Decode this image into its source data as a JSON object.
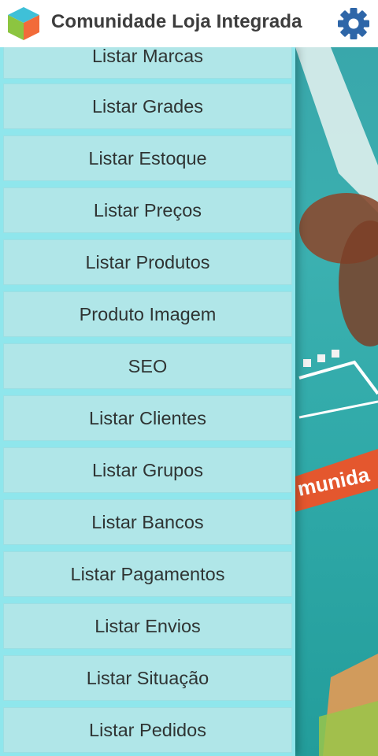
{
  "header": {
    "title": "Comunidade Loja Integrada",
    "logo_icon": "cube-logo-icon",
    "settings_icon": "gear-icon",
    "settings_color": "#2e66a8"
  },
  "drawer": {
    "background": "#8fe6ec",
    "item_background": "#b0e6e8",
    "items": [
      {
        "label": "Listar Marcas"
      },
      {
        "label": "Listar Grades"
      },
      {
        "label": "Listar Estoque"
      },
      {
        "label": "Listar Preços"
      },
      {
        "label": "Listar Produtos"
      },
      {
        "label": "Produto Imagem"
      },
      {
        "label": "SEO"
      },
      {
        "label": "Listar Clientes"
      },
      {
        "label": "Listar Grupos"
      },
      {
        "label": "Listar Bancos"
      },
      {
        "label": "Listar Pagamentos"
      },
      {
        "label": "Listar Envios"
      },
      {
        "label": "Listar Situação"
      },
      {
        "label": "Listar Pedidos"
      }
    ]
  },
  "background_art": {
    "banner_text": "munida"
  }
}
